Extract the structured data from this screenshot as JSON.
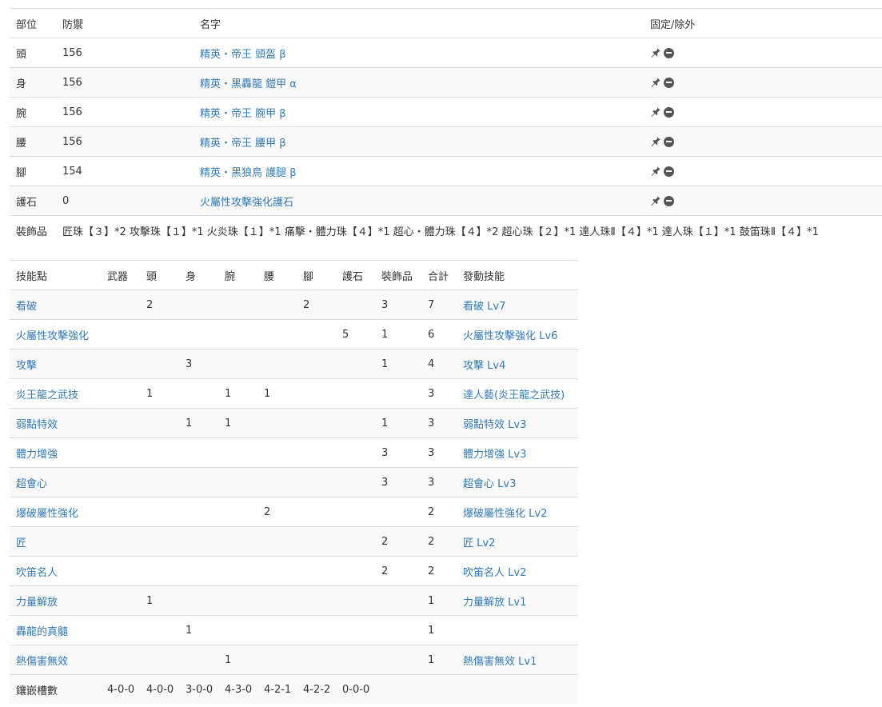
{
  "armor": {
    "headers": [
      "部位",
      "防禦",
      "名字",
      "固定/除外"
    ],
    "rows": [
      {
        "part": "頭",
        "defense": "156",
        "name": "精英・帝王 頭盔 β"
      },
      {
        "part": "身",
        "defense": "156",
        "name": "精英・黑轟龍 鎧甲 α"
      },
      {
        "part": "腕",
        "defense": "156",
        "name": "精英・帝王 腕甲 β"
      },
      {
        "part": "腰",
        "defense": "156",
        "name": "精英・帝王 腰甲 β"
      },
      {
        "part": "腳",
        "defense": "154",
        "name": "精英・黑狼鳥 護腿 β"
      },
      {
        "part": "護石",
        "defense": "0",
        "name": "火屬性攻擊強化護石"
      }
    ],
    "decorations_label": "裝飾品",
    "decorations_value": "匠珠【３】*2 攻擊珠【１】*1 火炎珠【１】*1 痛擊・體力珠【４】*1 超心・體力珠【４】*2 超心珠【２】*1 達人珠Ⅱ【４】*1 達人珠【１】*1 鼓笛珠Ⅱ【４】*1"
  },
  "skills": {
    "headers": [
      "技能點",
      "武器",
      "頭",
      "身",
      "腕",
      "腰",
      "腳",
      "護石",
      "裝飾品",
      "合計",
      "發動技能"
    ],
    "rows": [
      {
        "name": "看破",
        "weapon": "",
        "head": "2",
        "body": "",
        "arm": "",
        "waist": "",
        "leg": "2",
        "charm": "",
        "deco": "3",
        "total": "7",
        "active": "看破 Lv7"
      },
      {
        "name": "火屬性攻擊強化",
        "weapon": "",
        "head": "",
        "body": "",
        "arm": "",
        "waist": "",
        "leg": "",
        "charm": "5",
        "deco": "1",
        "total": "6",
        "active": "火屬性攻擊強化 Lv6"
      },
      {
        "name": "攻擊",
        "weapon": "",
        "head": "",
        "body": "3",
        "arm": "",
        "waist": "",
        "leg": "",
        "charm": "",
        "deco": "1",
        "total": "4",
        "active": "攻擊 Lv4"
      },
      {
        "name": "炎王龍之武技",
        "weapon": "",
        "head": "1",
        "body": "",
        "arm": "1",
        "waist": "1",
        "leg": "",
        "charm": "",
        "deco": "",
        "total": "3",
        "active": "達人藝(炎王龍之武技)"
      },
      {
        "name": "弱點特效",
        "weapon": "",
        "head": "",
        "body": "1",
        "arm": "1",
        "waist": "",
        "leg": "",
        "charm": "",
        "deco": "1",
        "total": "3",
        "active": "弱點特效 Lv3"
      },
      {
        "name": "體力增強",
        "weapon": "",
        "head": "",
        "body": "",
        "arm": "",
        "waist": "",
        "leg": "",
        "charm": "",
        "deco": "3",
        "total": "3",
        "active": "體力增強 Lv3"
      },
      {
        "name": "超會心",
        "weapon": "",
        "head": "",
        "body": "",
        "arm": "",
        "waist": "",
        "leg": "",
        "charm": "",
        "deco": "3",
        "total": "3",
        "active": "超會心 Lv3"
      },
      {
        "name": "爆破屬性強化",
        "weapon": "",
        "head": "",
        "body": "",
        "arm": "",
        "waist": "2",
        "leg": "",
        "charm": "",
        "deco": "",
        "total": "2",
        "active": "爆破屬性強化 Lv2"
      },
      {
        "name": "匠",
        "weapon": "",
        "head": "",
        "body": "",
        "arm": "",
        "waist": "",
        "leg": "",
        "charm": "",
        "deco": "2",
        "total": "2",
        "active": "匠 Lv2"
      },
      {
        "name": "吹笛名人",
        "weapon": "",
        "head": "",
        "body": "",
        "arm": "",
        "waist": "",
        "leg": "",
        "charm": "",
        "deco": "2",
        "total": "2",
        "active": "吹笛名人 Lv2"
      },
      {
        "name": "力量解放",
        "weapon": "",
        "head": "1",
        "body": "",
        "arm": "",
        "waist": "",
        "leg": "",
        "charm": "",
        "deco": "",
        "total": "1",
        "active": "力量解放 Lv1"
      },
      {
        "name": "轟龍的真髓",
        "weapon": "",
        "head": "",
        "body": "1",
        "arm": "",
        "waist": "",
        "leg": "",
        "charm": "",
        "deco": "",
        "total": "1",
        "active": ""
      },
      {
        "name": "熱傷害無效",
        "weapon": "",
        "head": "",
        "body": "",
        "arm": "1",
        "waist": "",
        "leg": "",
        "charm": "",
        "deco": "",
        "total": "1",
        "active": "熱傷害無效 Lv1"
      }
    ],
    "slots_label": "鑲嵌槽數",
    "slots": [
      "4-0-0",
      "4-0-0",
      "3-0-0",
      "4-3-0",
      "4-2-1",
      "4-2-2",
      "0-0-0"
    ]
  },
  "icons": {
    "pin": "pin-icon",
    "exclude": "minus-circle-icon"
  },
  "colors": {
    "link": "#337ab7",
    "border": "#dddddd",
    "stripe": "#f9f9f9"
  }
}
